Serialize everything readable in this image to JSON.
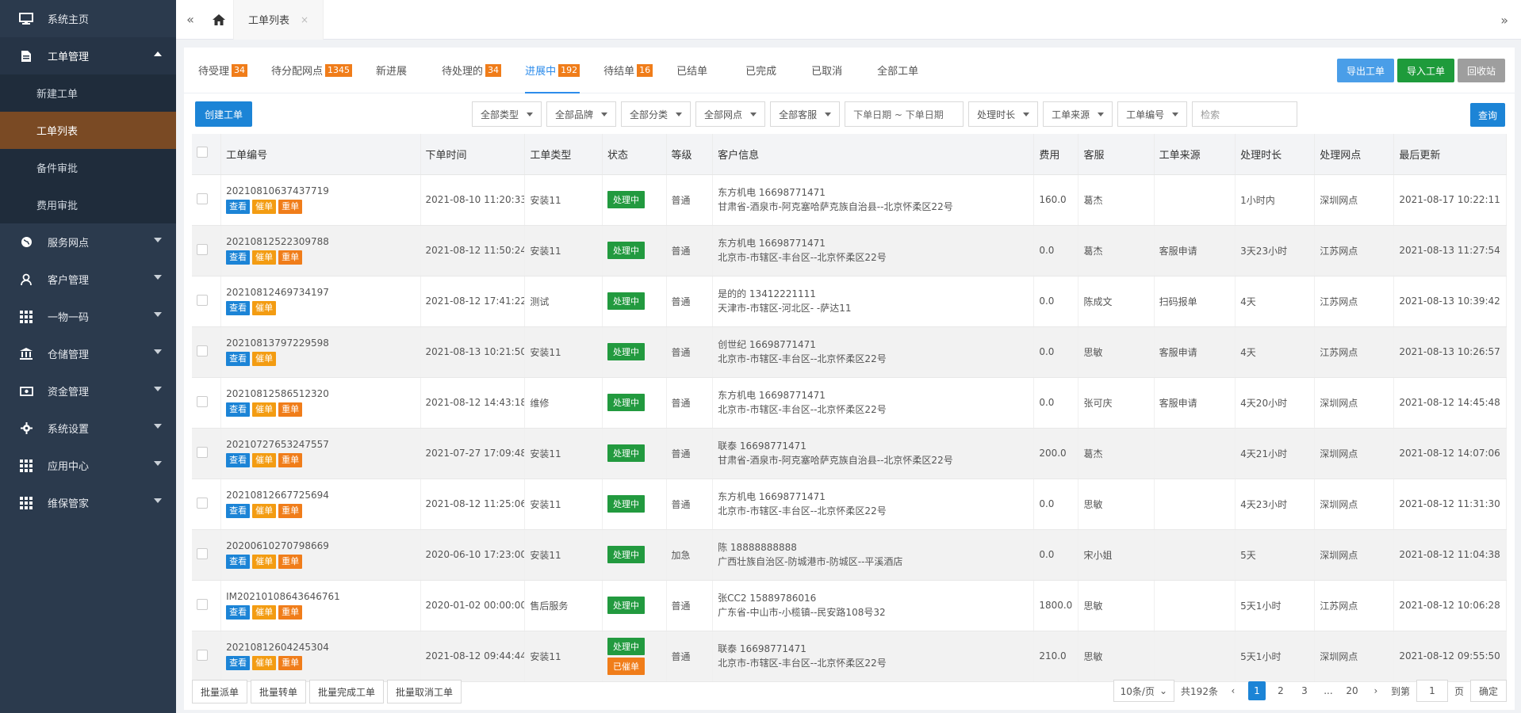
{
  "sidebar": {
    "items": [
      {
        "label": "系统主页",
        "icon": "monitor-icon"
      },
      {
        "label": "工单管理",
        "icon": "document-icon"
      },
      {
        "label": "服务网点",
        "icon": "globe-icon"
      },
      {
        "label": "客户管理",
        "icon": "user-icon"
      },
      {
        "label": "一物一码",
        "icon": "grid-icon"
      },
      {
        "label": "仓储管理",
        "icon": "bank-icon"
      },
      {
        "label": "资金管理",
        "icon": "money-icon"
      },
      {
        "label": "系统设置",
        "icon": "gear-icon"
      },
      {
        "label": "应用中心",
        "icon": "grid-icon"
      },
      {
        "label": "维保管家",
        "icon": "grid-icon"
      }
    ],
    "submenu": [
      "新建工单",
      "工单列表",
      "备件审批",
      "费用审批"
    ],
    "active_sub": "工单列表"
  },
  "topbar": {
    "tab_label": "工单列表",
    "left_icon": "double-left-icon",
    "home_icon": "home-icon",
    "right_icon": "double-right-icon"
  },
  "status_tabs": [
    {
      "label": "待受理",
      "count": "34"
    },
    {
      "label": "待分配网点",
      "count": "1345"
    },
    {
      "label": "新进展",
      "count": ""
    },
    {
      "label": "待处理的",
      "count": "34"
    },
    {
      "label": "进展中",
      "count": "192"
    },
    {
      "label": "待结单",
      "count": "16"
    },
    {
      "label": "已结单",
      "count": ""
    },
    {
      "label": "已完成",
      "count": ""
    },
    {
      "label": "已取消",
      "count": ""
    },
    {
      "label": "全部工单",
      "count": ""
    }
  ],
  "actions": {
    "export": "导出工单",
    "import": "导入工单",
    "recycle": "回收站"
  },
  "create_label": "创建工单",
  "filters": {
    "type": "全部类型",
    "brand": "全部品牌",
    "category": "全部分类",
    "network": "全部网点",
    "service": "全部客服",
    "date_range": "下单日期 ~ 下单日期",
    "duration": "处理时长",
    "source": "工单来源",
    "id_field": "工单编号",
    "search_placeholder": "检索",
    "query": "查询"
  },
  "table": {
    "headers": [
      "工单编号",
      "下单时间",
      "工单类型",
      "状态",
      "等级",
      "客户信息",
      "费用",
      "客服",
      "工单来源",
      "处理时长",
      "处理网点",
      "最后更新"
    ],
    "action_labels": {
      "view": "查看",
      "urge": "催单",
      "resend": "重单"
    },
    "rows": [
      {
        "id": "20210810637437719",
        "actions": [
          "view",
          "urge",
          "resend"
        ],
        "time": "2021-08-10 11:20:33",
        "type": "安装11",
        "status": [
          "处理中"
        ],
        "level": "普通",
        "cust1": "东方机电 16698771471",
        "cust2": "甘肃省-酒泉市-阿克塞哈萨克族自治县--北京怀柔区22号",
        "fee": "160.0",
        "service": "葛杰",
        "source": "",
        "duration": "1小时内",
        "dur_red": false,
        "network": "深圳网点",
        "updated": "2021-08-17 10:22:11"
      },
      {
        "id": "20210812522309788",
        "actions": [
          "view",
          "urge",
          "resend"
        ],
        "time": "2021-08-12 11:50:24",
        "type": "安装11",
        "status": [
          "处理中"
        ],
        "level": "普通",
        "cust1": "东方机电 16698771471",
        "cust2": "北京市-市辖区-丰台区--北京怀柔区22号",
        "fee": "0.0",
        "service": "葛杰",
        "source": "客服申请",
        "duration": "3天23小时",
        "dur_red": true,
        "network": "江苏网点",
        "updated": "2021-08-13 11:27:54"
      },
      {
        "id": "20210812469734197",
        "actions": [
          "view",
          "urge"
        ],
        "time": "2021-08-12 17:41:22",
        "type": "测试",
        "status": [
          "处理中"
        ],
        "level": "普通",
        "cust1": "是的的 13412221111",
        "cust2": "天津市-市辖区-河北区- -萨达11",
        "fee": "0.0",
        "service": "陈成文",
        "source": "扫码报单",
        "duration": "4天",
        "dur_red": true,
        "network": "江苏网点",
        "updated": "2021-08-13 10:39:42"
      },
      {
        "id": "20210813797229598",
        "actions": [
          "view",
          "urge"
        ],
        "time": "2021-08-13 10:21:50",
        "type": "安装11",
        "status": [
          "处理中"
        ],
        "level": "普通",
        "cust1": "创世纪 16698771471",
        "cust2": "北京市-市辖区-丰台区--北京怀柔区22号",
        "fee": "0.0",
        "service": "思敏",
        "source": "客服申请",
        "duration": "4天",
        "dur_red": true,
        "network": "江苏网点",
        "updated": "2021-08-13 10:26:57"
      },
      {
        "id": "20210812586512320",
        "actions": [
          "view",
          "urge",
          "resend"
        ],
        "time": "2021-08-12 14:43:18",
        "type": "维修",
        "status": [
          "处理中"
        ],
        "level": "普通",
        "cust1": "东方机电 16698771471",
        "cust2": "北京市-市辖区-丰台区--北京怀柔区22号",
        "fee": "0.0",
        "service": "张可庆",
        "source": "客服申请",
        "duration": "4天20小时",
        "dur_red": true,
        "network": "深圳网点",
        "updated": "2021-08-12 14:45:48"
      },
      {
        "id": "20210727653247557",
        "actions": [
          "view",
          "urge",
          "resend"
        ],
        "time": "2021-07-27 17:09:48",
        "type": "安装11",
        "status": [
          "处理中"
        ],
        "level": "普通",
        "cust1": "联泰 16698771471",
        "cust2": "甘肃省-酒泉市-阿克塞哈萨克族自治县--北京怀柔区22号",
        "fee": "200.0",
        "service": "葛杰",
        "source": "",
        "duration": "4天21小时",
        "dur_red": true,
        "network": "深圳网点",
        "updated": "2021-08-12 14:07:06"
      },
      {
        "id": "20210812667725694",
        "actions": [
          "view",
          "urge",
          "resend"
        ],
        "time": "2021-08-12 11:25:06",
        "type": "安装11",
        "status": [
          "处理中"
        ],
        "level": "普通",
        "cust1": "东方机电 16698771471",
        "cust2": "北京市-市辖区-丰台区--北京怀柔区22号",
        "fee": "0.0",
        "service": "思敏",
        "source": "",
        "duration": "4天23小时",
        "dur_red": true,
        "network": "深圳网点",
        "updated": "2021-08-12 11:31:30"
      },
      {
        "id": "20200610270798669",
        "actions": [
          "view",
          "urge",
          "resend"
        ],
        "time": "2020-06-10 17:23:00",
        "type": "安装11",
        "status": [
          "处理中"
        ],
        "level": "加急",
        "cust1": "陈 18888888888",
        "cust2": "广西壮族自治区-防城港市-防城区--平溪酒店",
        "fee": "0.0",
        "service": "宋小姐",
        "source": "",
        "duration": "5天",
        "dur_red": true,
        "network": "深圳网点",
        "updated": "2021-08-12 11:04:38"
      },
      {
        "id": "IM20210108643646761",
        "actions": [
          "view",
          "urge",
          "resend"
        ],
        "time": "2020-01-02 00:00:00",
        "type": "售后服务",
        "status": [
          "处理中"
        ],
        "level": "普通",
        "cust1": "张CC2 15889786016",
        "cust2": "广东省-中山市-小榄镇--民安路108号32",
        "fee": "1800.0",
        "service": "思敏",
        "source": "",
        "duration": "5天1小时",
        "dur_red": true,
        "network": "江苏网点",
        "updated": "2021-08-12 10:06:28"
      },
      {
        "id": "20210812604245304",
        "actions": [
          "view",
          "urge",
          "resend"
        ],
        "time": "2021-08-12 09:44:44",
        "type": "安装11",
        "status": [
          "处理中",
          "已催单"
        ],
        "level": "普通",
        "cust1": "联泰 16698771471",
        "cust2": "北京市-市辖区-丰台区--北京怀柔区22号",
        "fee": "210.0",
        "service": "思敏",
        "source": "",
        "duration": "5天1小时",
        "dur_red": true,
        "network": "深圳网点",
        "updated": "2021-08-12 09:55:50"
      }
    ]
  },
  "footer": {
    "batch": [
      "批量派单",
      "批量转单",
      "批量完成工单",
      "批量取消工单"
    ],
    "page_size": "10条/页",
    "total": "共192条",
    "pages": [
      "1",
      "2",
      "3",
      "...",
      "20"
    ],
    "goto": "到第",
    "goto_value": "1",
    "page_unit": "页",
    "confirm": "确定"
  },
  "colors": {
    "sidebar": "#2b3a4d",
    "active_sub": "#7a4a24",
    "primary": "#1c84d6",
    "badge": "#f07d1a",
    "status_green": "#229a3f"
  }
}
